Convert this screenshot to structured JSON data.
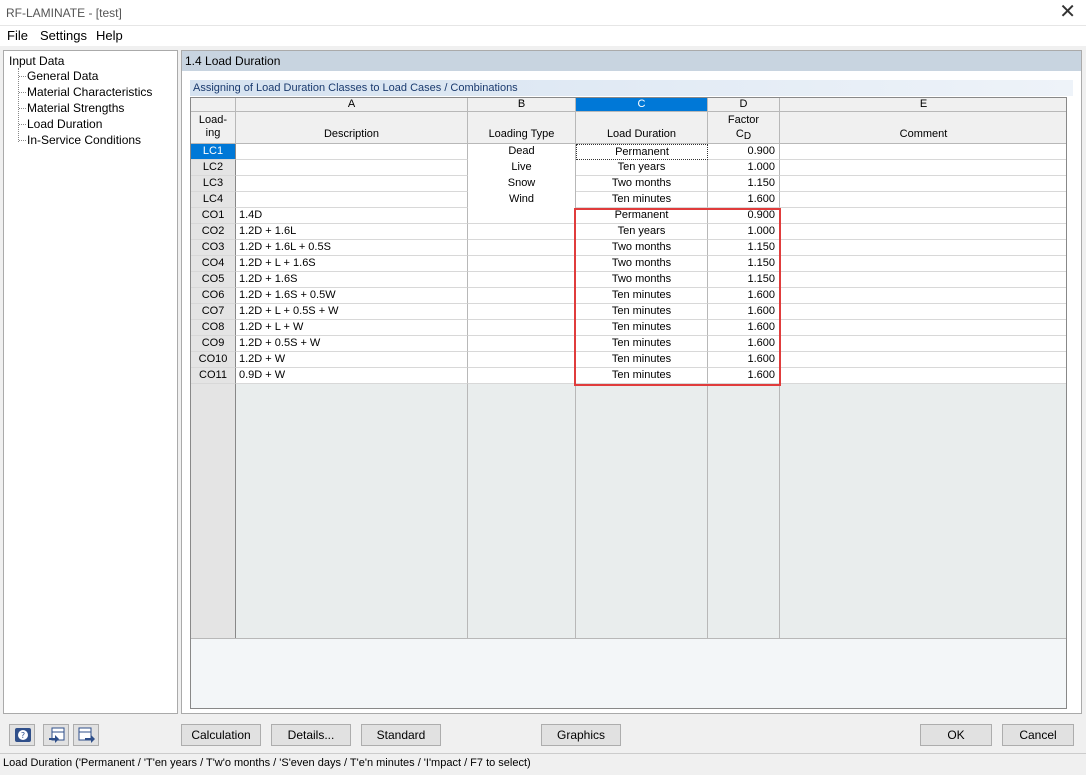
{
  "window": {
    "title": "RF-LAMINATE - [test]"
  },
  "menu": [
    "File",
    "Settings",
    "Help"
  ],
  "tree": {
    "root": "Input Data",
    "items": [
      "General Data",
      "Material Characteristics",
      "Material Strengths",
      "Load Duration",
      "In-Service Conditions"
    ]
  },
  "section": {
    "title": "1.4 Load Duration",
    "subtitle": "Assigning of Load Duration Classes to Load Cases / Combinations"
  },
  "table": {
    "col_letters": [
      "A",
      "B",
      "C",
      "D",
      "E"
    ],
    "headers": {
      "loading_1": "Load-",
      "loading_2": "ing",
      "description": "Description",
      "loading_type": "Loading Type",
      "load_duration": "Load Duration",
      "factor": "Factor",
      "factor_symbol": "C",
      "factor_sub": "D",
      "comment": "Comment"
    },
    "rows": [
      {
        "id": "LC1",
        "desc": "",
        "type": "Dead",
        "duration": "Permanent",
        "factor": "0.900"
      },
      {
        "id": "LC2",
        "desc": "",
        "type": "Live",
        "duration": "Ten years",
        "factor": "1.000"
      },
      {
        "id": "LC3",
        "desc": "",
        "type": "Snow",
        "duration": "Two months",
        "factor": "1.150"
      },
      {
        "id": "LC4",
        "desc": "",
        "type": "Wind",
        "duration": "Ten minutes",
        "factor": "1.600"
      },
      {
        "id": "CO1",
        "desc": "1.4D",
        "type": "",
        "duration": "Permanent",
        "factor": "0.900"
      },
      {
        "id": "CO2",
        "desc": "1.2D + 1.6L",
        "type": "",
        "duration": "Ten years",
        "factor": "1.000"
      },
      {
        "id": "CO3",
        "desc": "1.2D + 1.6L + 0.5S",
        "type": "",
        "duration": "Two months",
        "factor": "1.150"
      },
      {
        "id": "CO4",
        "desc": "1.2D + L + 1.6S",
        "type": "",
        "duration": "Two months",
        "factor": "1.150"
      },
      {
        "id": "CO5",
        "desc": "1.2D + 1.6S",
        "type": "",
        "duration": "Two months",
        "factor": "1.150"
      },
      {
        "id": "CO6",
        "desc": "1.2D + 1.6S + 0.5W",
        "type": "",
        "duration": "Ten minutes",
        "factor": "1.600"
      },
      {
        "id": "CO7",
        "desc": "1.2D + L + 0.5S + W",
        "type": "",
        "duration": "Ten minutes",
        "factor": "1.600"
      },
      {
        "id": "CO8",
        "desc": "1.2D + L + W",
        "type": "",
        "duration": "Ten minutes",
        "factor": "1.600"
      },
      {
        "id": "CO9",
        "desc": "1.2D + 0.5S + W",
        "type": "",
        "duration": "Ten minutes",
        "factor": "1.600"
      },
      {
        "id": "CO10",
        "desc": "1.2D + W",
        "type": "",
        "duration": "Ten minutes",
        "factor": "1.600"
      },
      {
        "id": "CO11",
        "desc": "0.9D + W",
        "type": "",
        "duration": "Ten minutes",
        "factor": "1.600"
      }
    ]
  },
  "buttons": {
    "calculation": "Calculation",
    "details": "Details...",
    "standard": "Standard",
    "graphics": "Graphics",
    "ok": "OK",
    "cancel": "Cancel"
  },
  "status": "Load Duration ('Permanent / 'T'en years / T'w'o months / 'S'even days / T'e'n minutes / 'I'mpact / F7 to select)",
  "colors": {
    "selection": "#0078d7",
    "highlight_box": "#e03c3c",
    "section_header": "#c8d4e0"
  }
}
